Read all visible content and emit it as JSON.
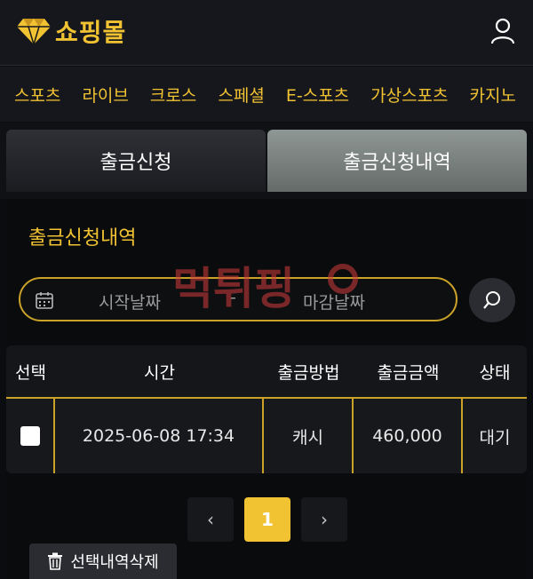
{
  "header": {
    "logo_text": "쇼핑몰",
    "icons": {
      "logo": "diamond-icon",
      "user": "user-icon"
    },
    "accent_color": "#f1c232"
  },
  "nav": {
    "items": [
      "스포츠",
      "라이브",
      "크로스",
      "스페셜",
      "E-스포츠",
      "가상스포츠",
      "카지노"
    ]
  },
  "tabs": {
    "request_label": "출금신청",
    "history_label": "출금신청내역"
  },
  "panel": {
    "title": "출금신청내역",
    "date_start_placeholder": "시작날짜",
    "date_separator": "-",
    "date_end_placeholder": "마감날짜"
  },
  "table": {
    "headers": [
      "선택",
      "시간",
      "출금방법",
      "출금금액",
      "상태"
    ],
    "rows": [
      {
        "time": "2025-06-08 17:34",
        "method": "캐시",
        "amount": "460,000",
        "status": "대기"
      }
    ]
  },
  "pagination": {
    "prev": "‹",
    "current": "1",
    "next": "›"
  },
  "actions": {
    "delete_label": "선택내역삭제"
  },
  "watermark": {
    "text": "먹튀핑"
  }
}
